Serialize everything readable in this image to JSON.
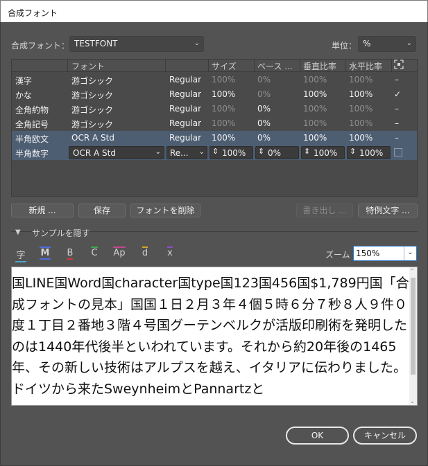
{
  "window": {
    "title": "合成フォント"
  },
  "top": {
    "font_label": "合成フォント：",
    "font_value": "TESTFONT",
    "unit_label": "単位：",
    "unit_value": "%"
  },
  "table": {
    "headers": [
      "フォント",
      "サイズ",
      "ベース ...",
      "垂直比率",
      "水平比率"
    ],
    "rows": [
      {
        "name": "漢字",
        "font": "游ゴシック",
        "style": "Regular",
        "size": "100%",
        "base": "0%",
        "vert": "100%",
        "horiz": "100%",
        "mark": "–"
      },
      {
        "name": "かな",
        "font": "游ゴシック",
        "style": "Regular",
        "size": "100%",
        "base": "0%",
        "vert": "100%",
        "horiz": "100%",
        "mark": "✓"
      },
      {
        "name": "全角約物",
        "font": "游ゴシック",
        "style": "Regular",
        "size": "100%",
        "base": "0%",
        "vert": "100%",
        "horiz": "100%",
        "mark": "–"
      },
      {
        "name": "全角記号",
        "font": "游ゴシック",
        "style": "Regular",
        "size": "100%",
        "base": "0%",
        "vert": "100%",
        "horiz": "100%",
        "mark": "–"
      },
      {
        "name": "半角欧文",
        "font": "OCR A Std",
        "style": "Regular",
        "size": "100%",
        "base": "0%",
        "vert": "100%",
        "horiz": "100%",
        "mark": "–"
      }
    ],
    "edit_row": {
      "name": "半角数字",
      "font": "OCR A Std",
      "style": "Re...",
      "size": "100%",
      "base": "0%",
      "vert": "100%",
      "horiz": "100%"
    }
  },
  "buttons": {
    "new": "新規 ...",
    "save": "保存",
    "delete": "フォントを削除",
    "export": "書き出し ...",
    "exceptions": "特例文字 ..."
  },
  "sample": {
    "toggle_label": "サンプルを隠す",
    "zoom_label": "ズーム",
    "zoom_value": "150%",
    "text": "国LINE国Word国character国type国123国456国$1,789円国「合成フォントの見本」国国１日２月３年４個５時６分７秒８人９件０度１丁目２番地３階４号国グーテンベルクが活版印刷術を発明したのは1440年代後半といわれています。それから約20年後の1465年、その新しい技術はアルプスを越え、イタリアに伝わりました。ドイツから来たSweynheimとPannartzと"
  },
  "tools": {
    "kanji": "字",
    "m": "M",
    "b": "B",
    "c": "C",
    "ap": "Ap",
    "d": "d",
    "x": "x"
  },
  "footer": {
    "ok": "OK",
    "cancel": "キャンセル"
  },
  "colors": {
    "panel": "#535353",
    "selected_row": "#4d5e73",
    "tool_m": "#4f6bd8",
    "tool_b": "#d23c3c",
    "tool_c": "#3ba64b",
    "tool_ap": "#c4458a",
    "tool_d": "#d6a429",
    "tool_x": "#8a4fc6"
  }
}
